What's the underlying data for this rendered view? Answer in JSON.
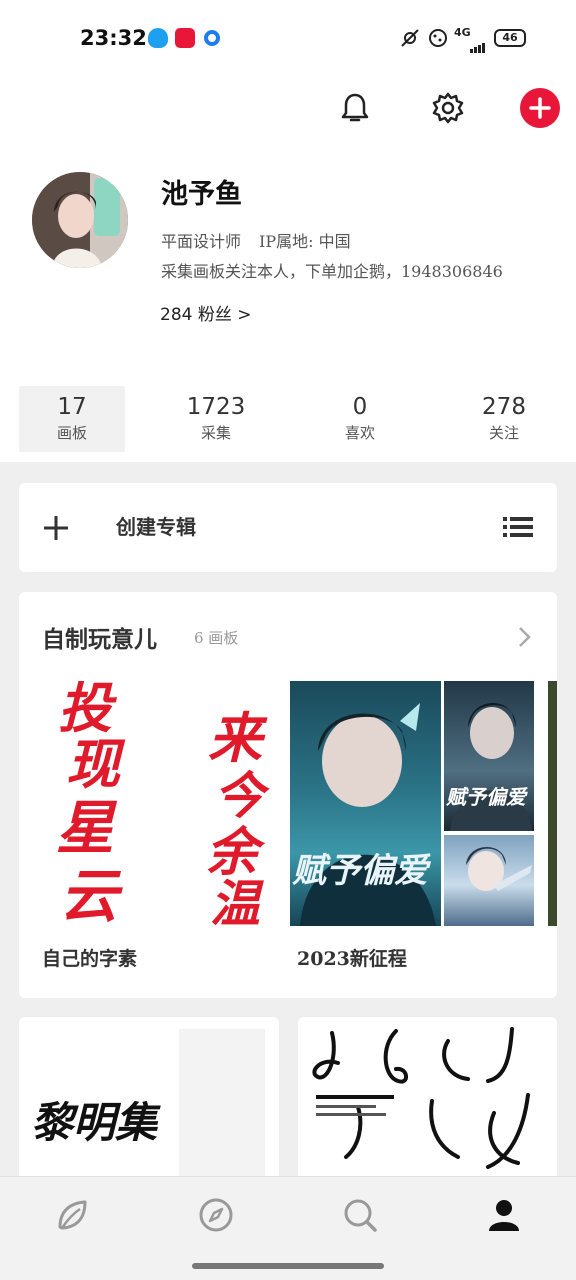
{
  "status": {
    "time": "23:32",
    "network": "4G",
    "battery": "46"
  },
  "header": {
    "icons": [
      "bell-icon",
      "gear-icon",
      "plus-icon"
    ],
    "accent": "#e8173a"
  },
  "profile": {
    "name": "池予鱼",
    "role": "平面设计师",
    "ip": "IP属地: 中国",
    "bio": "采集画板关注本人，下单加企鹅，1948306846",
    "followers": "284 粉丝 >"
  },
  "stats": [
    {
      "num": "17",
      "label": "画板"
    },
    {
      "num": "1723",
      "label": "采集"
    },
    {
      "num": "0",
      "label": "喜欢"
    },
    {
      "num": "278",
      "label": "关注"
    }
  ],
  "create": {
    "label": "创建专辑"
  },
  "album": {
    "title": "自制玩意儿",
    "count": "6 画板",
    "boards": [
      {
        "name": "自己的字素"
      },
      {
        "name": "2023新征程"
      }
    ]
  },
  "artwork": {
    "calli_left": [
      "投",
      "现",
      "星",
      "云"
    ],
    "calli_right": [
      "来",
      "今",
      "余",
      "温"
    ],
    "poster_title": "赋予偏爱",
    "bottom_left_title": "黎明集"
  },
  "tabbar": {
    "icons": [
      "leaf-icon",
      "compass-icon",
      "search-icon",
      "profile-icon"
    ]
  }
}
